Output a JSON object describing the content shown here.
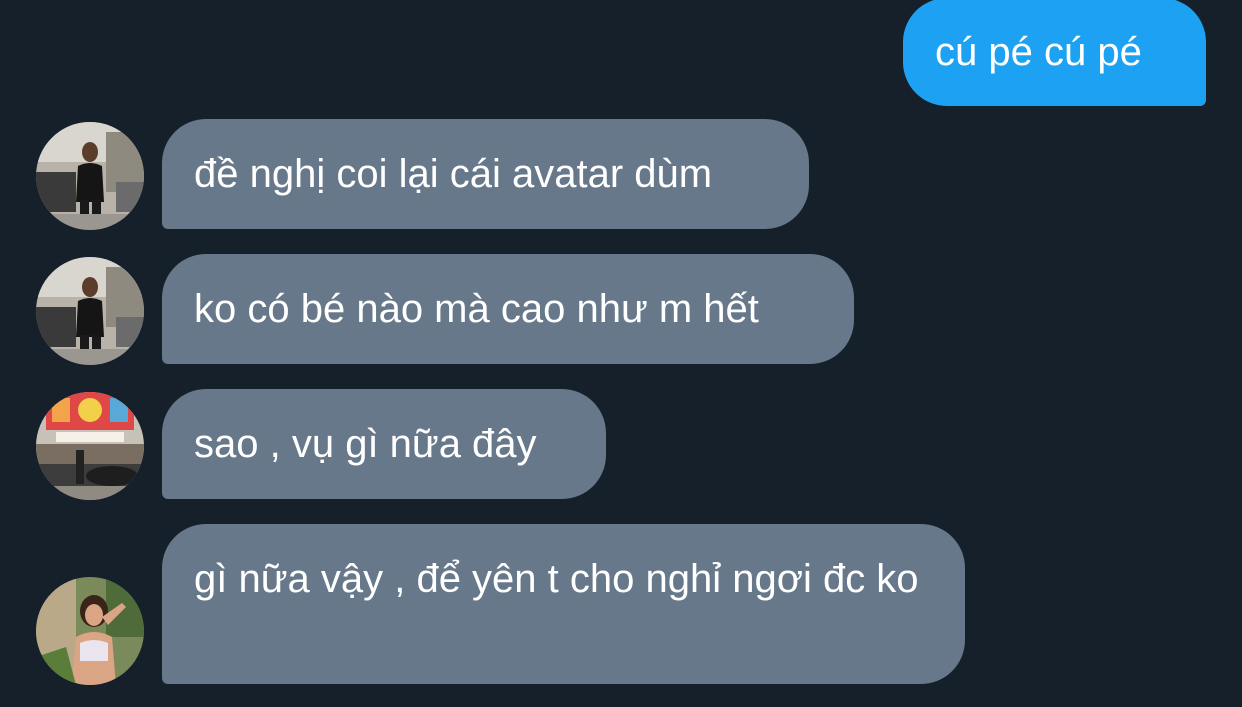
{
  "conversation": {
    "messages": [
      {
        "direction": "outgoing",
        "text": "cú pé cú pé"
      },
      {
        "direction": "incoming",
        "text": "đề nghị coi lại cái avatar dùm",
        "avatar": "woman-street-black-outfit-photo"
      },
      {
        "direction": "incoming",
        "text": "ko có bé nào mà cao như m hết",
        "avatar": "woman-street-black-outfit-photo"
      },
      {
        "direction": "incoming",
        "text": "sao , vụ gì nữa đây",
        "avatar": "street-storefront-photo"
      },
      {
        "direction": "incoming",
        "text": "gì nữa vậy , để yên t cho nghỉ ngơi đc ko",
        "avatar": "woman-outdoor-sports-top-photo"
      }
    ]
  },
  "colors": {
    "background": "#15202b",
    "outgoing_bubble": "#1da1f2",
    "incoming_bubble": "#66788a",
    "text": "#ffffff"
  }
}
